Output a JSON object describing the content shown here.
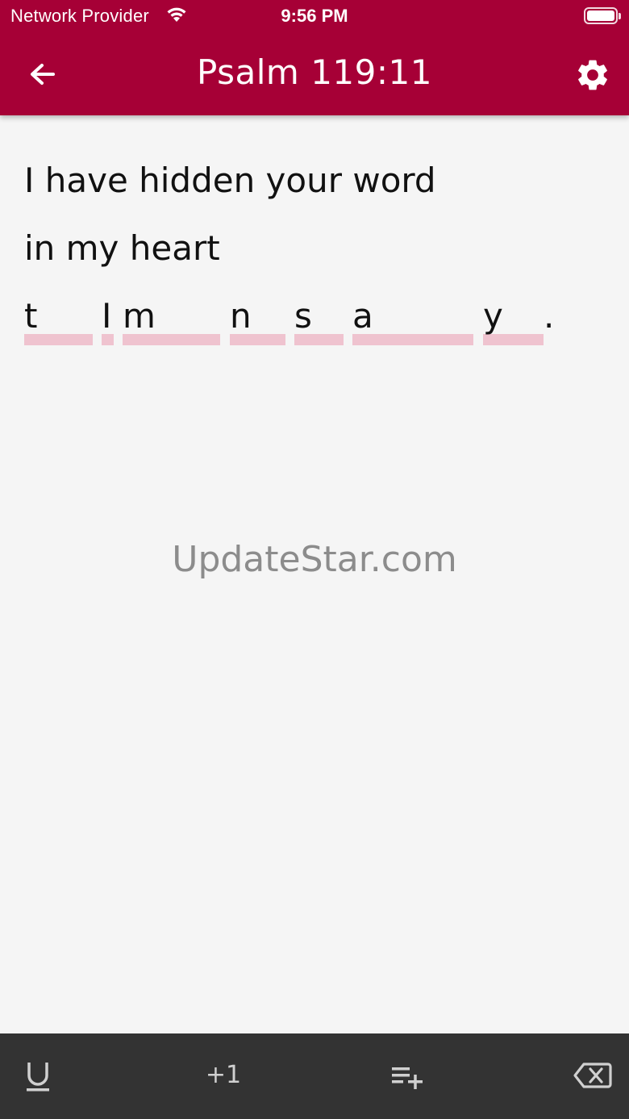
{
  "status_bar": {
    "carrier": "Network Provider",
    "time": "9:56 PM"
  },
  "header": {
    "title": "Psalm 119:11",
    "back_icon": "arrow-left-icon",
    "settings_icon": "gear-icon",
    "background_color": "#a60036"
  },
  "verse": {
    "lines": [
      "I have hidden your word",
      "in my heart"
    ],
    "blank_hints": [
      "t",
      "I",
      "m",
      "n",
      "s",
      "a",
      "y",
      "."
    ],
    "highlight_color": "#efc3cf"
  },
  "watermark": "UpdateStar.com",
  "toolbar": {
    "underline_icon": "underline-icon",
    "plus_one_label": "+1",
    "add_to_list_icon": "playlist-add-icon",
    "backspace_icon": "backspace-icon"
  }
}
